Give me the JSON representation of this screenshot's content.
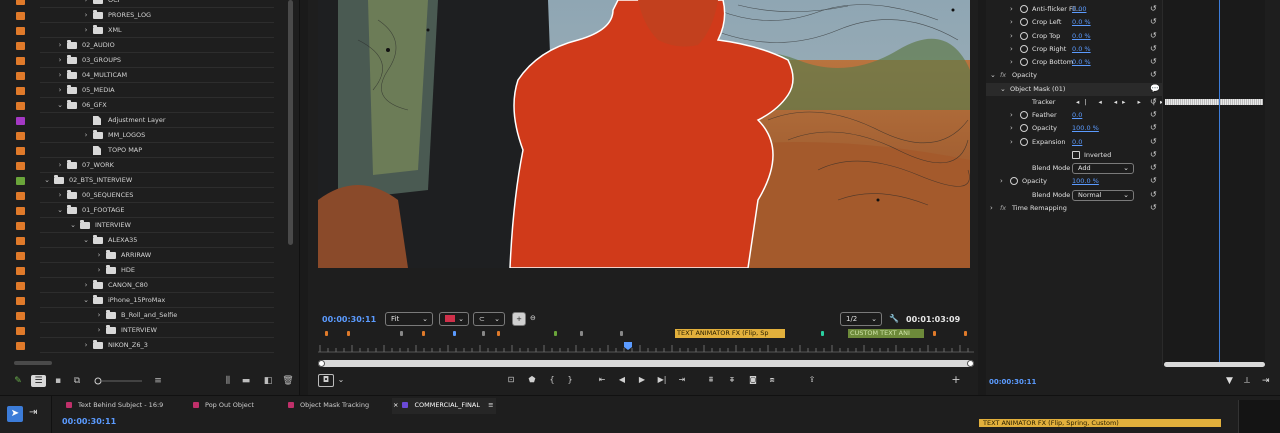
{
  "project": {
    "rows": [
      {
        "label": "OCF",
        "depth": 5,
        "kind": "folder",
        "swatch": "#e07a2a",
        "open": false
      },
      {
        "label": "PRORES_LOG",
        "depth": 5,
        "kind": "folder",
        "swatch": "#e07a2a",
        "open": false
      },
      {
        "label": "XML",
        "depth": 5,
        "kind": "folder",
        "swatch": "#e07a2a",
        "open": false
      },
      {
        "label": "02_AUDIO",
        "depth": 3,
        "kind": "folder",
        "swatch": "#e07a2a",
        "open": false
      },
      {
        "label": "03_GROUPS",
        "depth": 3,
        "kind": "folder",
        "swatch": "#e07a2a",
        "open": false
      },
      {
        "label": "04_MULTICAM",
        "depth": 3,
        "kind": "folder",
        "swatch": "#e07a2a",
        "open": false
      },
      {
        "label": "05_MEDIA",
        "depth": 3,
        "kind": "folder",
        "swatch": "#e07a2a",
        "open": false
      },
      {
        "label": "06_GFX",
        "depth": 3,
        "kind": "folder",
        "swatch": "#e07a2a",
        "open": true
      },
      {
        "label": "Adjustment Layer",
        "depth": 5,
        "kind": "file",
        "swatch": "#a438c4",
        "open": null
      },
      {
        "label": "MM_LOGOS",
        "depth": 5,
        "kind": "folder",
        "swatch": "#e07a2a",
        "open": false
      },
      {
        "label": "TOPO MAP",
        "depth": 5,
        "kind": "file",
        "swatch": "#e07a2a",
        "open": null
      },
      {
        "label": "07_WORK",
        "depth": 3,
        "kind": "folder",
        "swatch": "#e07a2a",
        "open": false
      },
      {
        "label": "02_BTS_INTERVIEW",
        "depth": 2,
        "kind": "folder",
        "swatch": "#6aa53a",
        "open": true
      },
      {
        "label": "00_SEQUENCES",
        "depth": 3,
        "kind": "folder",
        "swatch": "#e07a2a",
        "open": false
      },
      {
        "label": "01_FOOTAGE",
        "depth": 3,
        "kind": "folder",
        "swatch": "#e07a2a",
        "open": true
      },
      {
        "label": "INTERVIEW",
        "depth": 4,
        "kind": "folder",
        "swatch": "#e07a2a",
        "open": true
      },
      {
        "label": "ALEXA35",
        "depth": 5,
        "kind": "folder",
        "swatch": "#e07a2a",
        "open": true
      },
      {
        "label": "ARRIRAW",
        "depth": 6,
        "kind": "folder",
        "swatch": "#e07a2a",
        "open": false
      },
      {
        "label": "HDE",
        "depth": 6,
        "kind": "folder",
        "swatch": "#e07a2a",
        "open": false
      },
      {
        "label": "CANON_C80",
        "depth": 5,
        "kind": "folder",
        "swatch": "#e07a2a",
        "open": false
      },
      {
        "label": "iPhone_15ProMax",
        "depth": 5,
        "kind": "folder",
        "swatch": "#e07a2a",
        "open": true
      },
      {
        "label": "B_Roll_and_Selfie",
        "depth": 6,
        "kind": "folder",
        "swatch": "#e07a2a",
        "open": false
      },
      {
        "label": "INTERVIEW",
        "depth": 6,
        "kind": "folder",
        "swatch": "#e07a2a",
        "open": false
      },
      {
        "label": "NIKON_Z6_3",
        "depth": 5,
        "kind": "folder",
        "swatch": "#e07a2a",
        "open": false
      }
    ]
  },
  "program": {
    "current_tc": "00:00:30:11",
    "zoom_select": "Fit",
    "resolution_select": "1/2",
    "duration_tc": "00:01:03:09",
    "markers": [
      {
        "label": "TEXT ANIMATOR FX (Flip, Sp",
        "color": "#e2b03c"
      },
      {
        "label": "CUSTOM TEXT ANI",
        "color": "#6d8a3a"
      }
    ]
  },
  "effects": {
    "props": [
      {
        "name": "Anti-flicker Fil...",
        "value": "0.00",
        "level": 2,
        "hasArrow": true,
        "hasSw": true
      },
      {
        "name": "Crop Left",
        "value": "0.0 %",
        "level": 2,
        "hasArrow": true,
        "hasSw": true
      },
      {
        "name": "Crop Top",
        "value": "0.0 %",
        "level": 2,
        "hasArrow": true,
        "hasSw": true
      },
      {
        "name": "Crop Right",
        "value": "0.0 %",
        "level": 2,
        "hasArrow": true,
        "hasSw": true
      },
      {
        "name": "Crop Bottom",
        "value": "0.0 %",
        "level": 2,
        "hasArrow": true,
        "hasSw": true
      },
      {
        "name": "Opacity",
        "value": "",
        "level": 0,
        "hasArrow": true,
        "hasSw": false,
        "fx": true
      },
      {
        "name": "Object Mask (01)",
        "value": "",
        "level": 1,
        "hasArrow": true,
        "hasSw": false,
        "hl": true
      },
      {
        "name": "Tracker",
        "value": "",
        "level": 3,
        "hasArrow": false,
        "hasSw": false
      },
      {
        "name": "Feather",
        "value": "0.0",
        "level": 2,
        "hasArrow": true,
        "hasSw": true
      },
      {
        "name": "Opacity",
        "value": "100.0 %",
        "level": 2,
        "hasArrow": true,
        "hasSw": true
      },
      {
        "name": "Expansion",
        "value": "0.0",
        "level": 2,
        "hasArrow": true,
        "hasSw": true
      },
      {
        "name": "Inverted",
        "value": "",
        "level": 4,
        "hasArrow": false,
        "hasSw": false
      },
      {
        "name": "Blend Mode",
        "value": "",
        "level": 3,
        "hasArrow": false,
        "hasSw": false
      },
      {
        "name": "Opacity",
        "value": "100.0 %",
        "level": 1,
        "hasArrow": true,
        "hasSw": true
      },
      {
        "name": "Blend Mode",
        "value": "",
        "level": 3,
        "hasArrow": false,
        "hasSw": false
      },
      {
        "name": "Time Remapping",
        "value": "",
        "level": 0,
        "hasArrow": true,
        "hasSw": false,
        "fx": true
      }
    ],
    "mask_blend": "Add",
    "layer_blend": "Normal",
    "footer_tc": "00:00:30:11"
  },
  "timeline": {
    "tabs": [
      {
        "label": "Text Behind Subject - 16:9",
        "color": "#c0306a"
      },
      {
        "label": "Pop Out Object",
        "color": "#c0306a"
      },
      {
        "label": "Object Mask Tracking",
        "color": "#c0306a"
      },
      {
        "label": "COMMERCIAL_FINAL",
        "color": "#6b4ad6"
      }
    ],
    "current_tc": "00:00:30:11",
    "clip_label": "TEXT ANIMATOR FX (Flip, Spring, Custom)"
  }
}
